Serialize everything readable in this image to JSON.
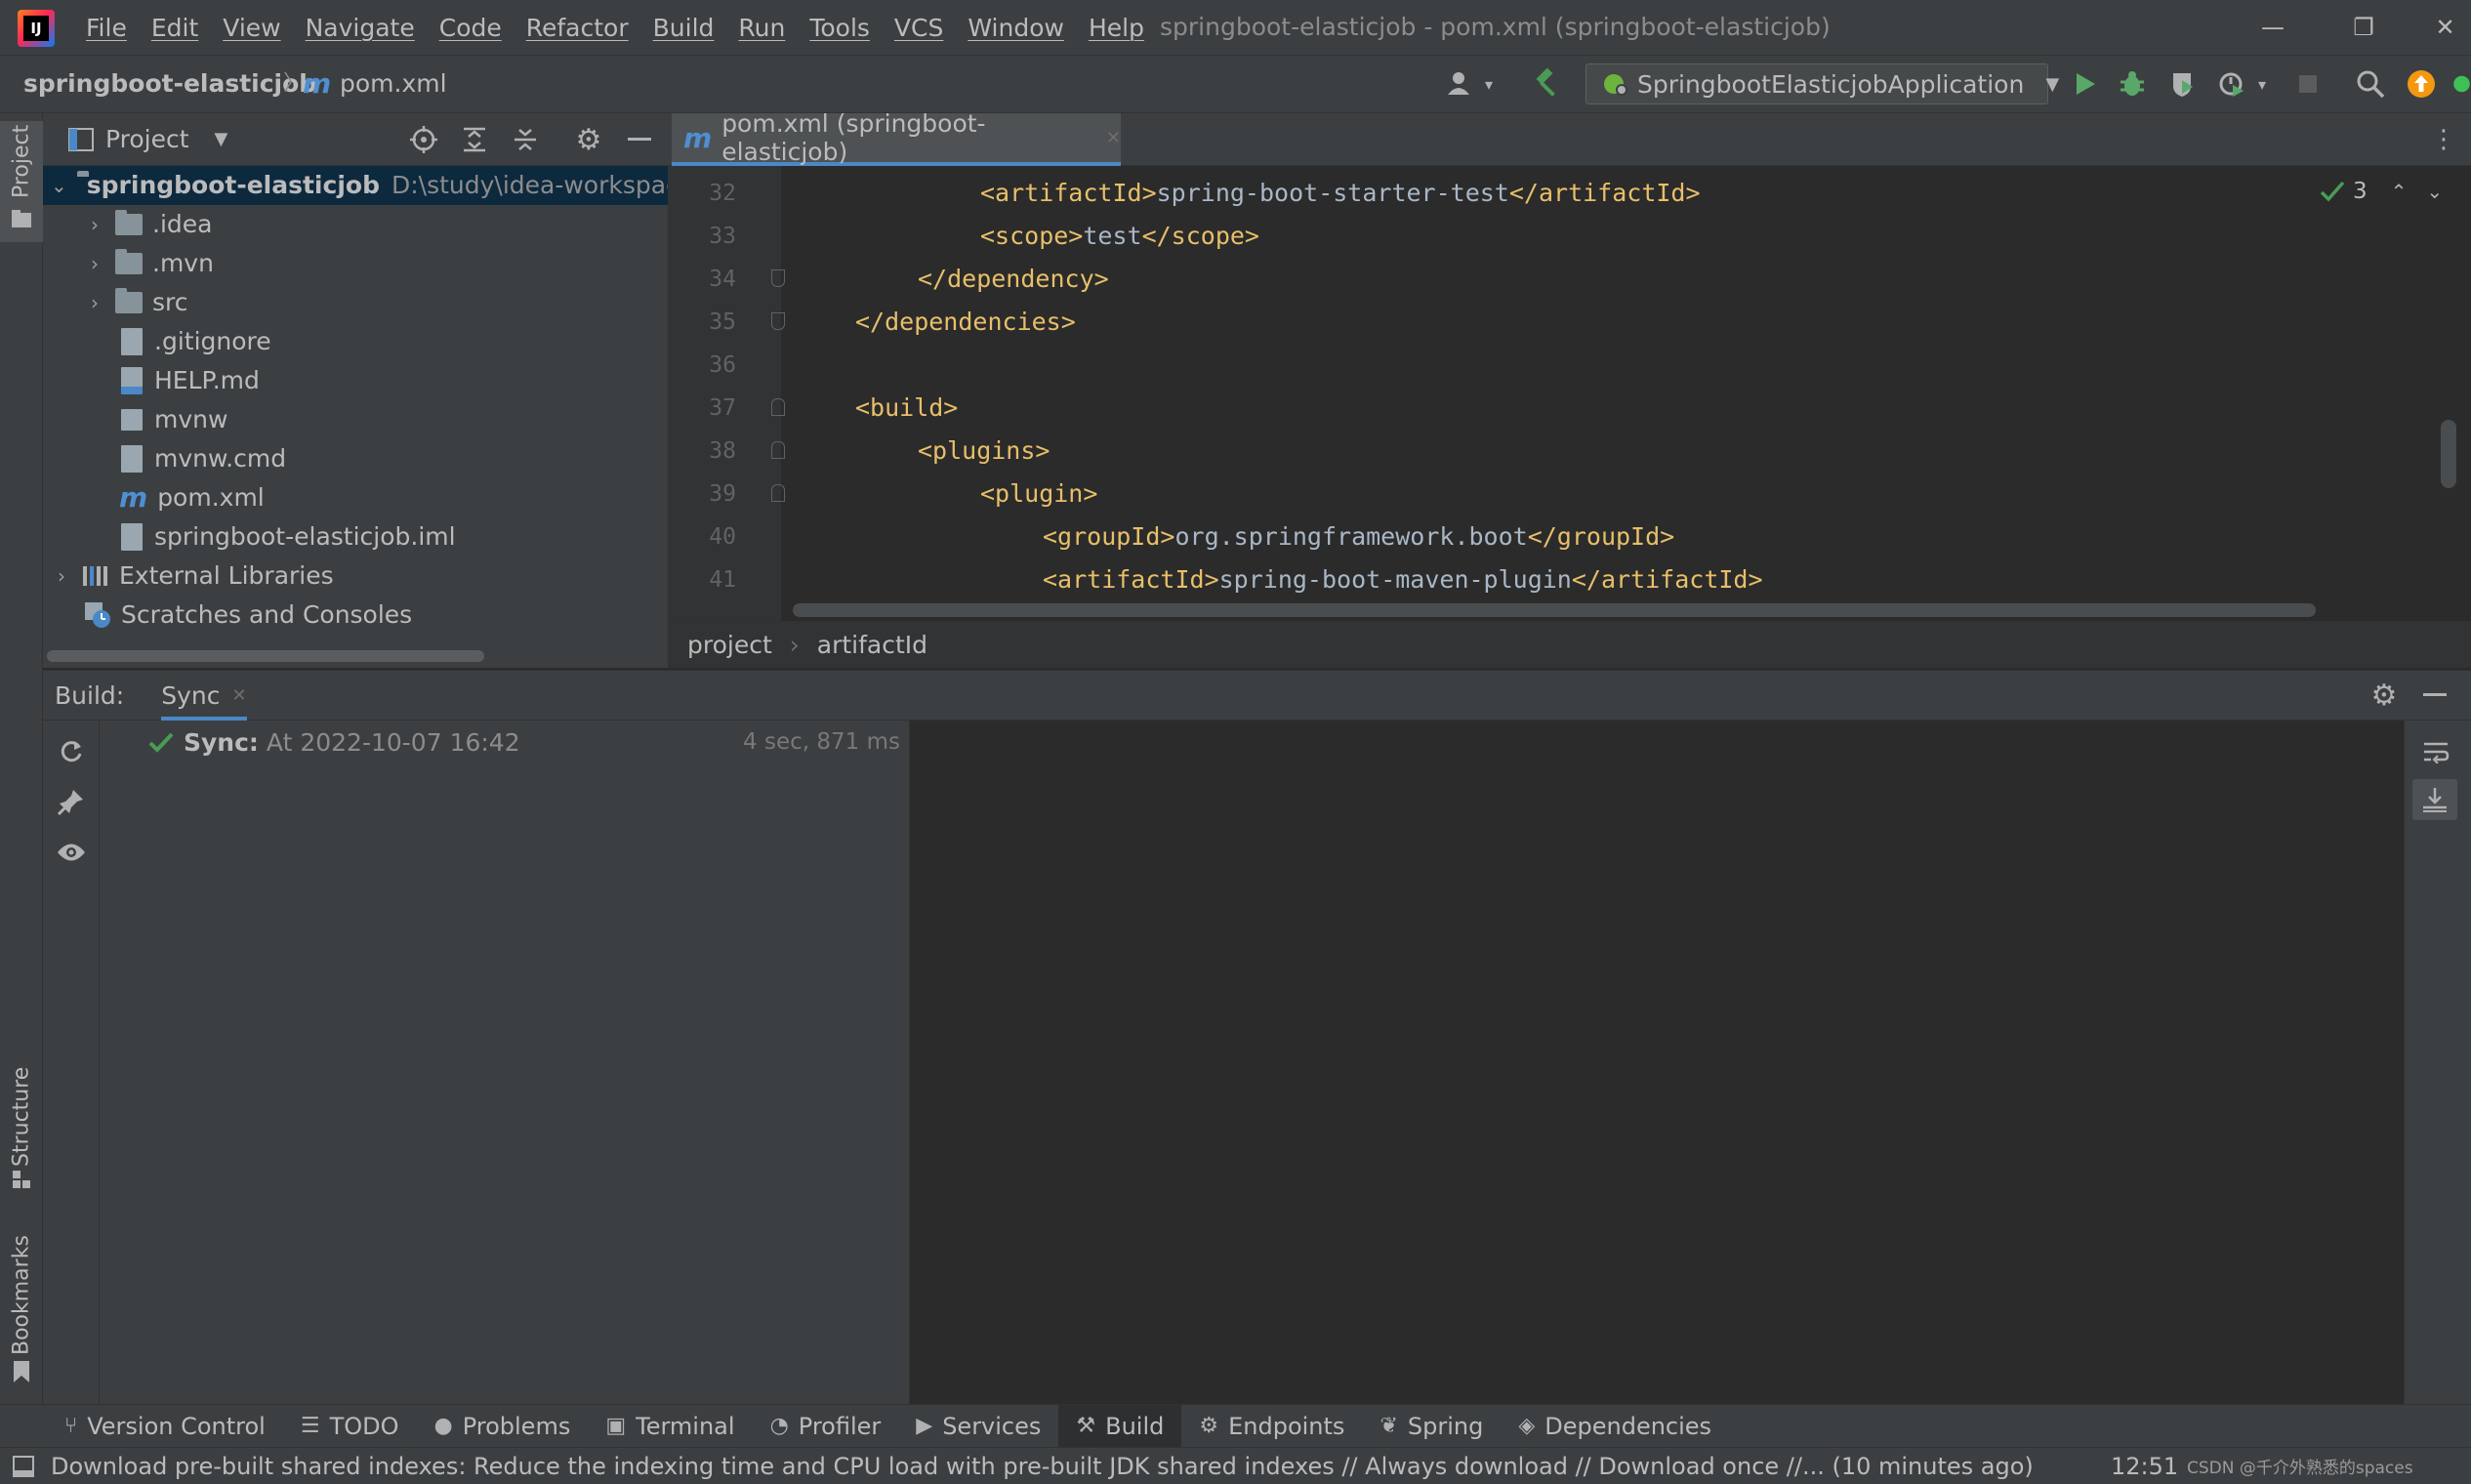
{
  "titlebar": {
    "logo_text": "IJ",
    "menu": [
      "File",
      "Edit",
      "View",
      "Navigate",
      "Code",
      "Refactor",
      "Build",
      "Run",
      "Tools",
      "VCS",
      "Window",
      "Help"
    ],
    "window_title": "springboot-elasticjob - pom.xml (springboot-elasticjob)",
    "minimize": "—",
    "restore": "❐",
    "close": "✕"
  },
  "navbar": {
    "project": "springboot-elasticjob",
    "separator": "〉",
    "file_icon": "m",
    "file": "pom.xml",
    "run_config": "SpringbootElasticjobApplication"
  },
  "left_strip": {
    "project_tab": "Project",
    "structure_tab": "Structure",
    "bookmarks_tab": "Bookmarks"
  },
  "project_panel": {
    "title": "Project",
    "root_name": "springboot-elasticjob",
    "root_path": "D:\\study\\idea-workspace",
    "items": [
      {
        "label": ".idea"
      },
      {
        "label": ".mvn"
      },
      {
        "label": "src"
      },
      {
        "label": ".gitignore"
      },
      {
        "label": "HELP.md"
      },
      {
        "label": "mvnw"
      },
      {
        "label": "mvnw.cmd"
      },
      {
        "label": "pom.xml"
      },
      {
        "label": "springboot-elasticjob.iml"
      },
      {
        "label": "External Libraries"
      },
      {
        "label": "Scratches and Consoles"
      }
    ]
  },
  "editor": {
    "tab_icon": "m",
    "tab_label": "pom.xml (springboot-elasticjob)",
    "tab_close": "✕",
    "inspection_count": "3",
    "line_numbers": [
      "32",
      "33",
      "34",
      "35",
      "36",
      "37",
      "38",
      "39",
      "40",
      "41"
    ],
    "lines": [
      {
        "open": "<artifactId>",
        "text": "spring-boot-starter-test",
        "close": "</artifactId>"
      },
      {
        "open": "<scope>",
        "text": "test",
        "close": "</scope>"
      },
      {
        "open": "</dependency>",
        "text": "",
        "close": ""
      },
      {
        "open": "</dependencies>",
        "text": "",
        "close": ""
      },
      {
        "open": "",
        "text": "",
        "close": ""
      },
      {
        "open": "<build>",
        "text": "",
        "close": ""
      },
      {
        "open": "<plugins>",
        "text": "",
        "close": ""
      },
      {
        "open": "<plugin>",
        "text": "",
        "close": ""
      },
      {
        "open": "<groupId>",
        "text": "org.springframework.boot",
        "close": "</groupId>"
      },
      {
        "open": "<artifactId>",
        "text": "spring-boot-maven-plugin",
        "close": "</artifactId>"
      }
    ],
    "breadcrumb": [
      "project",
      "artifactId"
    ],
    "breadcrumb_sep": "›"
  },
  "build_panel": {
    "label": "Build:",
    "tab": "Sync",
    "tab_close": "✕",
    "sync_label": "Sync:",
    "sync_time": "At 2022-10-07 16:42",
    "duration": "4 sec, 871 ms"
  },
  "bottom_tabs": [
    {
      "icon": "⑂",
      "label": "Version Control"
    },
    {
      "icon": "☰",
      "label": "TODO"
    },
    {
      "icon": "●",
      "label": "Problems"
    },
    {
      "icon": "▣",
      "label": "Terminal"
    },
    {
      "icon": "◔",
      "label": "Profiler"
    },
    {
      "icon": "▶",
      "label": "Services"
    },
    {
      "icon": "⚒",
      "label": "Build"
    },
    {
      "icon": "⚙",
      "label": "Endpoints"
    },
    {
      "icon": "❦",
      "label": "Spring"
    },
    {
      "icon": "◈",
      "label": "Dependencies"
    }
  ],
  "status_bar": {
    "message": "Download pre-built shared indexes: Reduce the indexing time and CPU load with pre-built JDK shared indexes // Always download // Download once //... (10 minutes ago)",
    "time": "12:51",
    "watermark": "CSDN @千介外熟悉的spaces"
  },
  "colors": {
    "accent": "#4a88c7",
    "tag": "#e8bf6a",
    "text": "#a9b7c6",
    "success": "#499c54",
    "run": "#59a869"
  }
}
